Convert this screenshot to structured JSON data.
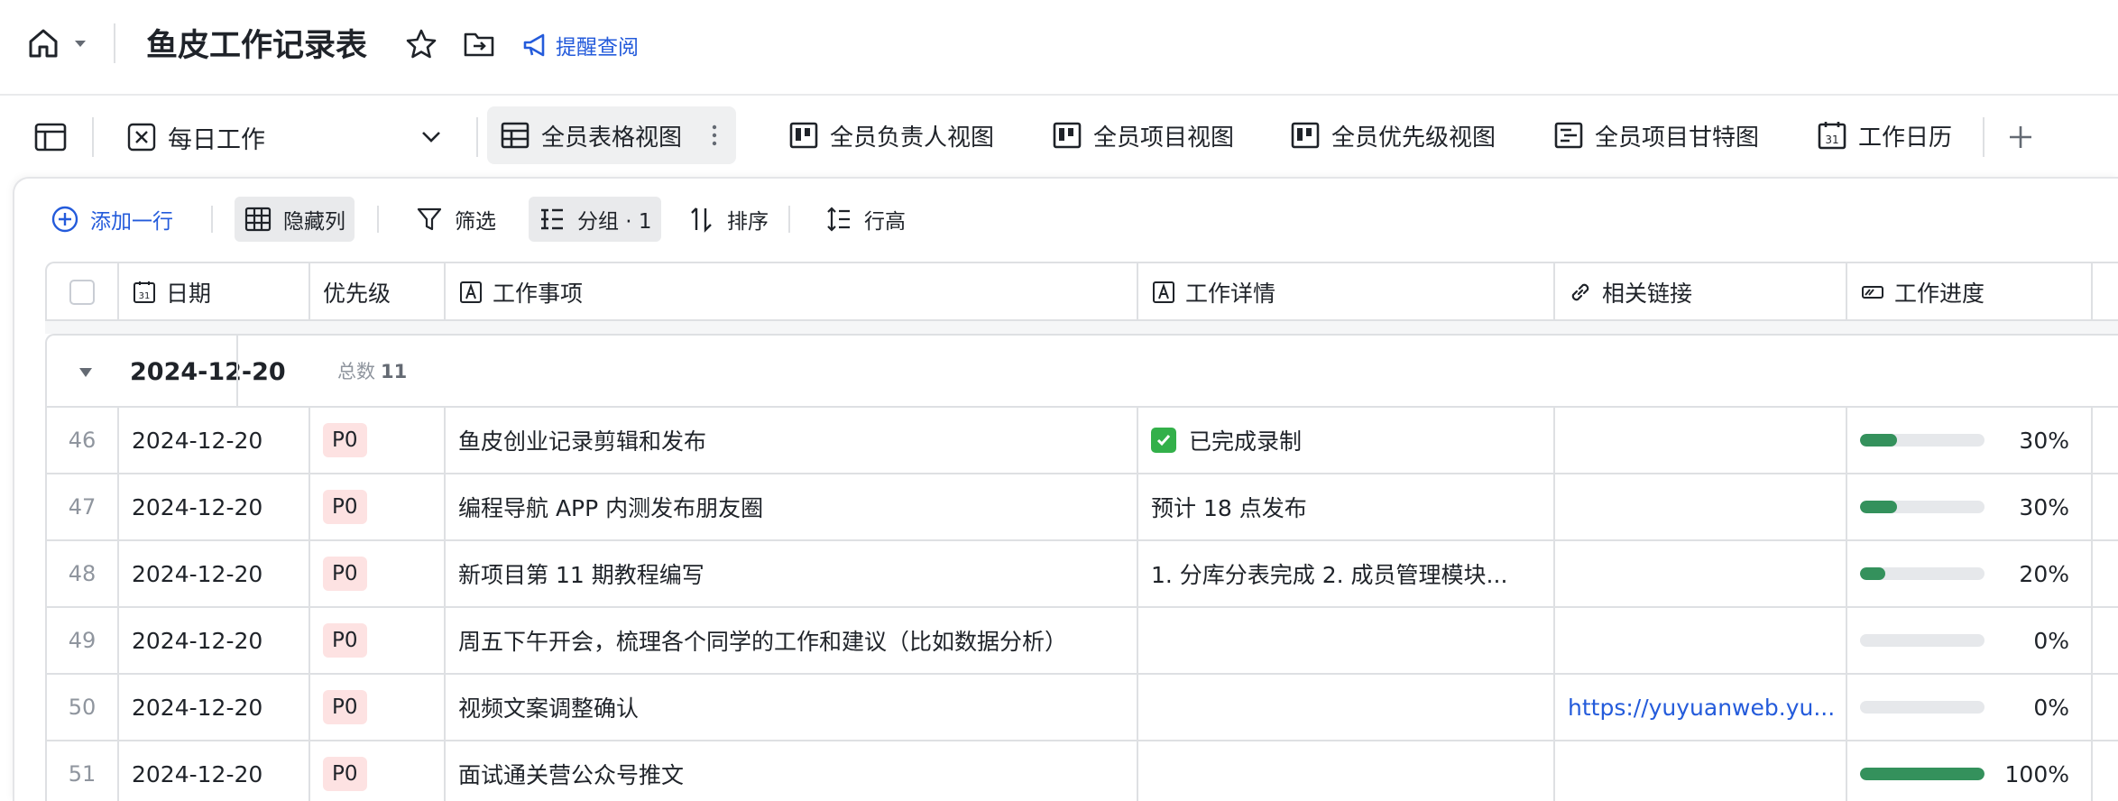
{
  "header": {
    "title": "鱼皮工作记录表",
    "remind_label": "提醒查阅"
  },
  "tabs": {
    "table_name": "每日工作",
    "views": [
      {
        "label": "全员表格视图",
        "icon": "grid-table-icon",
        "active": true
      },
      {
        "label": "全员负责人视图",
        "icon": "kanban-icon"
      },
      {
        "label": "全员项目视图",
        "icon": "kanban-icon"
      },
      {
        "label": "全员优先级视图",
        "icon": "kanban-icon"
      },
      {
        "label": "全员项目甘特图",
        "icon": "gantt-icon"
      },
      {
        "label": "工作日历",
        "icon": "calendar-icon"
      }
    ]
  },
  "toolbar": {
    "add_row": "添加一行",
    "hide_columns": "隐藏列",
    "filter": "筛选",
    "group": "分组 · 1",
    "sort": "排序",
    "row_height": "行高"
  },
  "columns": {
    "date": "日期",
    "priority": "优先级",
    "task": "工作事项",
    "detail": "工作详情",
    "link": "相关链接",
    "progress": "工作进度"
  },
  "group": {
    "date": "2024-12-20",
    "count_label": "总数",
    "count": "11"
  },
  "rows": [
    {
      "num": "46",
      "date": "2024-12-20",
      "priority": "P0",
      "task": "鱼皮创业记录剪辑和发布",
      "detail": "已完成录制",
      "detail_done": true,
      "link": "",
      "progress": 0.3,
      "progress_label": "30%"
    },
    {
      "num": "47",
      "date": "2024-12-20",
      "priority": "P0",
      "task": "编程导航 APP 内测发布朋友圈",
      "detail": "预计 18 点发布",
      "link": "",
      "progress": 0.3,
      "progress_label": "30%"
    },
    {
      "num": "48",
      "date": "2024-12-20",
      "priority": "P0",
      "task": "新项目第 11 期教程编写",
      "detail": "1. 分库分表完成 2. 成员管理模块...",
      "link": "",
      "progress": 0.2,
      "progress_label": "20%"
    },
    {
      "num": "49",
      "date": "2024-12-20",
      "priority": "P0",
      "task": "周五下午开会，梳理各个同学的工作和建议（比如数据分析）",
      "detail": "",
      "link": "",
      "progress": 0.0,
      "progress_label": "0%"
    },
    {
      "num": "50",
      "date": "2024-12-20",
      "priority": "P0",
      "task": "视频文案调整确认",
      "detail": "",
      "link": "https://yuyuanweb.yu...",
      "progress": 0.0,
      "progress_label": "0%"
    },
    {
      "num": "51",
      "date": "2024-12-20",
      "priority": "P0",
      "task": "面试通关营公众号推文",
      "detail": "",
      "link": "",
      "progress": 1.0,
      "progress_label": "100%"
    }
  ],
  "colors": {
    "accent": "#245bdb",
    "badge_bg": "#fde2e2",
    "progress_fill": "#34915c",
    "progress_track": "#e6e8eb"
  }
}
